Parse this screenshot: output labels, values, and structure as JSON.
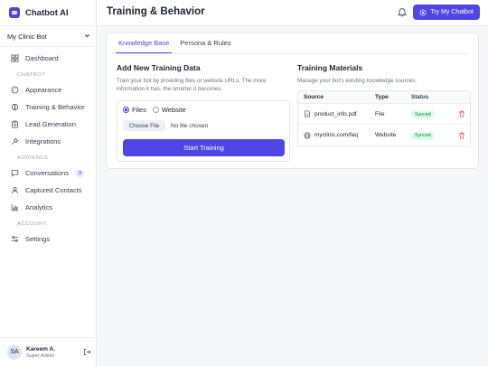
{
  "sidebar": {
    "brand": "Chatbot AI",
    "bot_select": "My Clinic Bot",
    "nav_main": [
      {
        "label": "Dashboard",
        "icon": "dashboard-icon"
      }
    ],
    "section_chatbot": "CHATBOT",
    "nav_chatbot": [
      {
        "label": "Appearance",
        "icon": "palette-icon"
      },
      {
        "label": "Training & Behavior",
        "icon": "brain-icon"
      },
      {
        "label": "Lead Generation",
        "icon": "clipboard-icon"
      },
      {
        "label": "Integrations",
        "icon": "plug-icon"
      }
    ],
    "section_audience": "AUDIENCE",
    "nav_audience": [
      {
        "label": "Conversations",
        "icon": "chat-icon",
        "badge": "3"
      },
      {
        "label": "Captured Contacts",
        "icon": "users-icon"
      },
      {
        "label": "Analytics",
        "icon": "chart-icon"
      }
    ],
    "section_account": "ACCOUNT",
    "nav_account": [
      {
        "label": "Settings",
        "icon": "sliders-icon"
      }
    ],
    "user": {
      "initials": "SA",
      "name": "Kareem A.",
      "role": "Super Admin"
    }
  },
  "header": {
    "title": "Training & Behavior",
    "try_button": "Try My Chatbot"
  },
  "tabs": [
    {
      "label": "Knowledge Base",
      "active": true
    },
    {
      "label": "Persona & Rules",
      "active": false
    }
  ],
  "training": {
    "title": "Add New Training Data",
    "description": "Train your bot by providing files or website URLs. The more information it has, the smarter it becomes.",
    "radio_files": "Files",
    "radio_website": "Website",
    "choose_file": "Choose File",
    "no_file": "No file chosen",
    "start_button": "Start Training"
  },
  "materials": {
    "title": "Training Materials",
    "description": "Manage your bot's existing knowledge sources.",
    "columns": [
      "Source",
      "Type",
      "Status"
    ],
    "rows": [
      {
        "source": "product_info.pdf",
        "type": "File",
        "status": "Synced",
        "icon": "file-icon"
      },
      {
        "source": "myclinic.com/faq",
        "type": "Website",
        "status": "Synced",
        "icon": "globe-icon"
      }
    ]
  },
  "colors": {
    "accent": "#4f46e5",
    "synced_bg": "#dcfce7",
    "synced_text": "#15803d",
    "danger": "#ef4444"
  }
}
